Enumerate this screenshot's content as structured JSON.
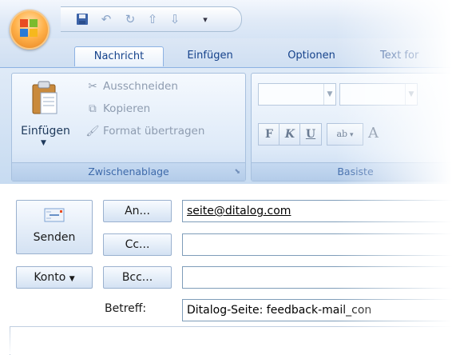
{
  "quick_access": {
    "icons": [
      "save-icon",
      "undo-icon",
      "redo-icon",
      "up-arrow-icon",
      "down-arrow-icon",
      "customize-dropdown-icon"
    ]
  },
  "tabs": [
    {
      "label": "Nachricht",
      "active": true
    },
    {
      "label": "Einfügen",
      "active": false
    },
    {
      "label": "Optionen",
      "active": false
    },
    {
      "label": "Text for",
      "active": false
    }
  ],
  "ribbon": {
    "clipboard": {
      "paste_label": "Einfügen",
      "cut_label": "Ausschneiden",
      "copy_label": "Kopieren",
      "format_painter_label": "Format übertragen",
      "group_label": "Zwischenablage"
    },
    "basic_text": {
      "group_label": "Basiste",
      "bold_label": "F",
      "italic_label": "K",
      "underline_label": "U",
      "highlight_label": "ab",
      "font_color_label": "A"
    }
  },
  "message": {
    "send_label": "Senden",
    "to_label": "An...",
    "cc_label": "Cc...",
    "bcc_label": "Bcc...",
    "account_label": "Konto",
    "subject_label": "Betreff:",
    "to_value": "seite@ditalog.com",
    "cc_value": "",
    "bcc_value": "",
    "subject_value": "Ditalog-Seite: feedback-mail_con"
  },
  "colors": {
    "accent": "#15428b",
    "ribbon_bg": "#c7dbf1",
    "office_button": "#ffb14a"
  }
}
